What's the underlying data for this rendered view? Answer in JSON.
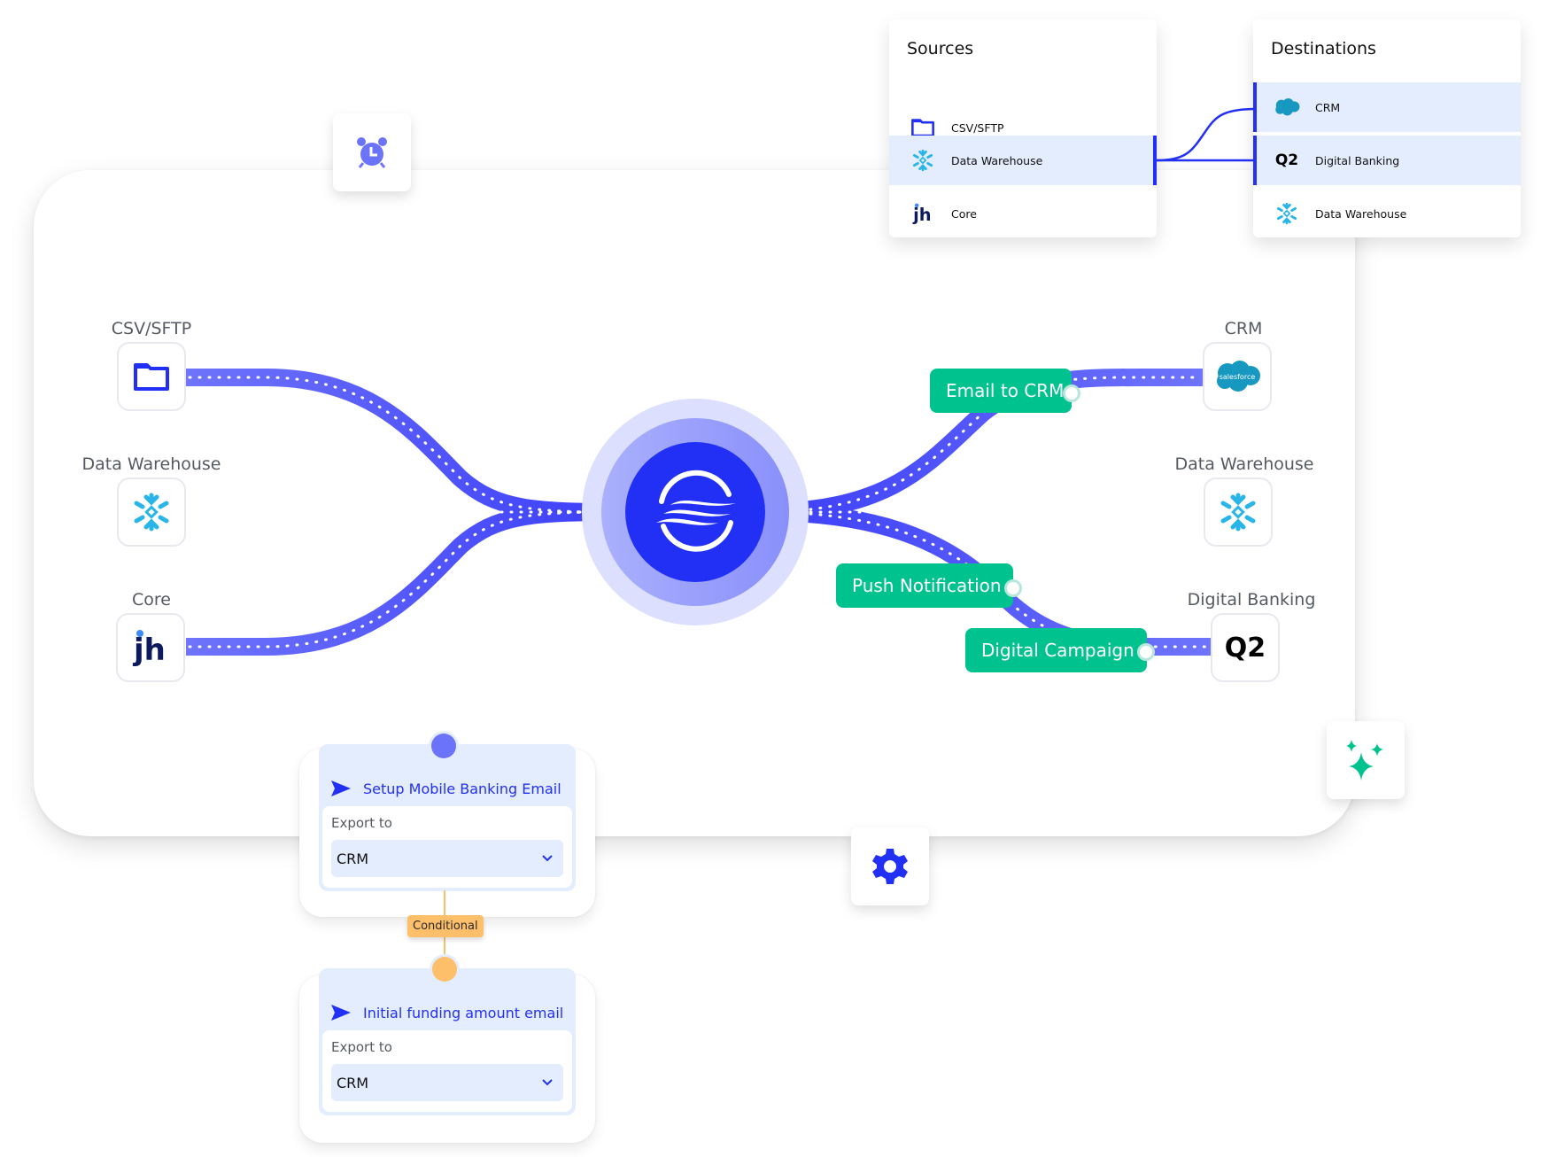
{
  "colors": {
    "path": "#5a5ffb",
    "path_dark": "#3b3ef9",
    "hub": "#2230f5",
    "pill": "#00c28e",
    "conditional": "#fdbf6a",
    "selected_row": "#e4edfd",
    "snowflake": "#29b5e8",
    "jh_navy": "#0d1b5e"
  },
  "toolbar": {
    "alarm_icon": "alarm-clock-icon",
    "settings_icon": "gear-icon",
    "ai_icon": "sparkles-icon"
  },
  "sources_panel": {
    "title": "Sources",
    "items": [
      {
        "label": "CSV/SFTP",
        "icon": "folder-icon",
        "selected": false
      },
      {
        "label": "Data Warehouse",
        "icon": "snowflake-icon",
        "selected": true
      },
      {
        "label": "Core",
        "icon": "jh-logo-icon",
        "selected": false
      }
    ]
  },
  "destinations_panel": {
    "title": "Destinations",
    "items": [
      {
        "label": "CRM",
        "icon": "salesforce-icon",
        "selected": true
      },
      {
        "label": "Digital Banking",
        "icon": "q2-logo-icon",
        "selected": true
      },
      {
        "label": "Data Warehouse",
        "icon": "snowflake-icon",
        "selected": false
      }
    ]
  },
  "flow": {
    "sources": [
      {
        "label": "CSV/SFTP",
        "icon": "folder-icon"
      },
      {
        "label": "Data Warehouse",
        "icon": "snowflake-icon"
      },
      {
        "label": "Core",
        "icon": "jh-logo-icon"
      }
    ],
    "hub_icon": "waves-logo-icon",
    "destinations": [
      {
        "label": "CRM",
        "icon": "salesforce-icon",
        "logo_text": "salesforce"
      },
      {
        "label": "Data Warehouse",
        "icon": "snowflake-icon"
      },
      {
        "label": "Digital Banking",
        "icon": "q2-logo-icon",
        "logo_text": "Q2"
      }
    ],
    "actions": [
      {
        "label": "Email to CRM"
      },
      {
        "label": "Push Notification"
      },
      {
        "label": "Digital Campaign"
      }
    ]
  },
  "workflow": {
    "steps": [
      {
        "title": "Setup Mobile Banking Email",
        "export_label": "Export to",
        "export_value": "CRM"
      },
      {
        "title": "Initial funding amount email",
        "export_label": "Export to",
        "export_value": "CRM"
      }
    ],
    "connector_label": "Conditional"
  }
}
